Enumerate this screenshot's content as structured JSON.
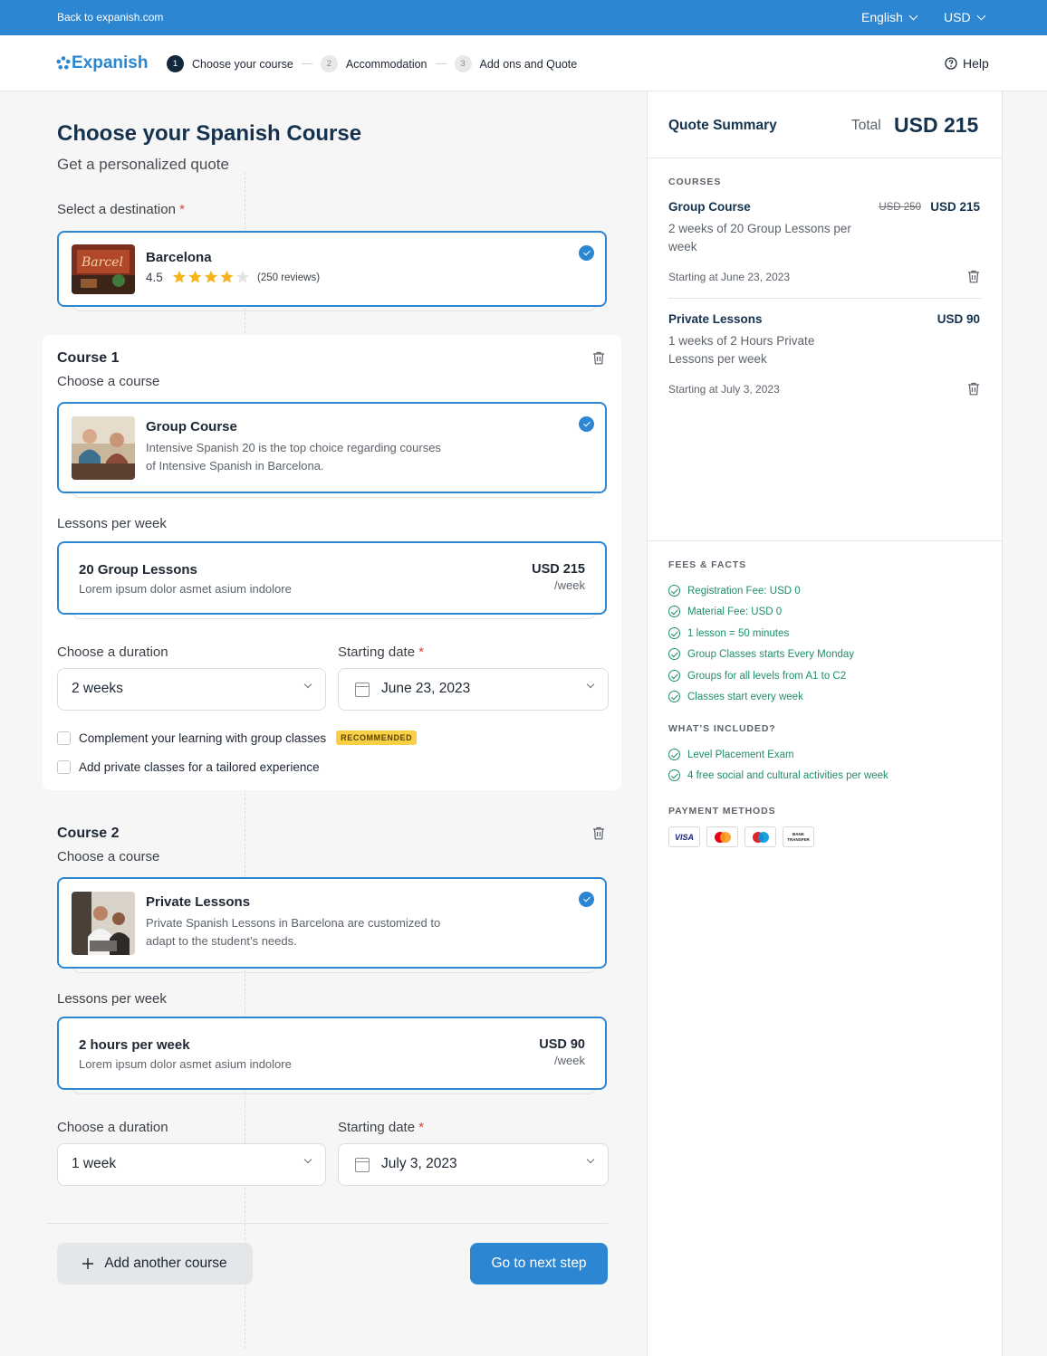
{
  "topbar": {
    "back_link": "Back to expanish.com",
    "language": "English",
    "currency": "USD"
  },
  "header": {
    "logo_text": "Expanish",
    "steps": [
      {
        "num": "1",
        "label": "Choose your course"
      },
      {
        "num": "2",
        "label": "Accommodation"
      },
      {
        "num": "3",
        "label": "Add ons and Quote"
      }
    ],
    "help": "Help"
  },
  "main": {
    "title": "Choose your Spanish Course",
    "subtitle": "Get a personalized quote",
    "destination_label": "Select a destination",
    "required_mark": "*",
    "destination": {
      "name": "Barcelona",
      "rating": "4.5",
      "stars": 4.5,
      "reviews": "(250 reviews)"
    },
    "courses": [
      {
        "heading": "Course 1",
        "subheading": "Choose a course",
        "course_title": "Group Course",
        "course_desc_1": "Intensive Spanish 20 is the top choice regarding courses",
        "course_desc_2": "of Intensive Spanish in Barcelona.",
        "lessons_label": "Lessons per week",
        "lesson_title": "20 Group Lessons",
        "lesson_desc": "Lorem ipsum dolor asmet asium indolore",
        "lesson_price": "USD 215",
        "lesson_unit": "/week",
        "duration_label": "Choose a duration",
        "duration_value": "2 weeks",
        "start_label": "Starting date",
        "start_value": "June 23, 2023",
        "option_1": "Complement your learning with group classes",
        "option_1_badge": "RECOMMENDED",
        "option_2_bold": "Add private classes",
        "option_2_rest": " for a tailored experience"
      },
      {
        "heading": "Course 2",
        "subheading": "Choose a course",
        "course_title": "Private Lessons",
        "course_desc_1": "Private Spanish Lessons in Barcelona are customized to",
        "course_desc_2": "adapt to the student’s needs.",
        "lessons_label": "Lessons per week",
        "lesson_title": "2 hours per week",
        "lesson_desc": "Lorem ipsum dolor asmet asium indolore",
        "lesson_price": "USD 90",
        "lesson_unit": "/week",
        "duration_label": "Choose a duration",
        "duration_value": "1 week",
        "start_label": "Starting date",
        "start_value": "July 3, 2023"
      }
    ],
    "add_course": "Add another course",
    "next_step": "Go to next step"
  },
  "summary": {
    "title": "Quote Summary",
    "total_label": "Total",
    "total_value": "USD 215",
    "courses_heading": "COURSES",
    "items": [
      {
        "title": "Group Course",
        "old_price": "USD 250",
        "price": "USD 215",
        "desc": "2 weeks of 20 Group Lessons per week",
        "date": "Starting at June 23, 2023"
      },
      {
        "title": "Private Lessons",
        "price": "USD 90",
        "desc": "1 weeks of 2 Hours Private Lessons per week",
        "date": "Starting at July 3, 2023"
      }
    ],
    "fees_heading": "FEES & FACTS",
    "fees": [
      "Registration Fee: USD 0",
      "Material Fee: USD 0",
      "1 lesson = 50 minutes",
      "Group Classes starts Every Monday",
      "Groups for all levels from A1 to C2",
      "Classes start every week"
    ],
    "included_heading": "WHAT’S INCLUDED?",
    "included": [
      "Level Placement Exam",
      "4 free social and cultural activities per week"
    ],
    "payment_heading": "PAYMENT METHODS",
    "payment": {
      "visa": "VISA",
      "bank_1": "BANK",
      "bank_2": "TRANSFER"
    }
  },
  "colors": {
    "brand_blue": "#2c86d2",
    "navy": "#14324e",
    "success_green": "#1f8e6a",
    "badge_yellow": "#f9cf46"
  },
  "icons": [
    "chevron-down-icon",
    "help-circle-icon",
    "check-circle-icon",
    "star-icon",
    "trash-icon",
    "calendar-icon",
    "plus-icon",
    "visa-icon",
    "mastercard-icon",
    "maestro-icon",
    "bank-transfer-icon"
  ]
}
